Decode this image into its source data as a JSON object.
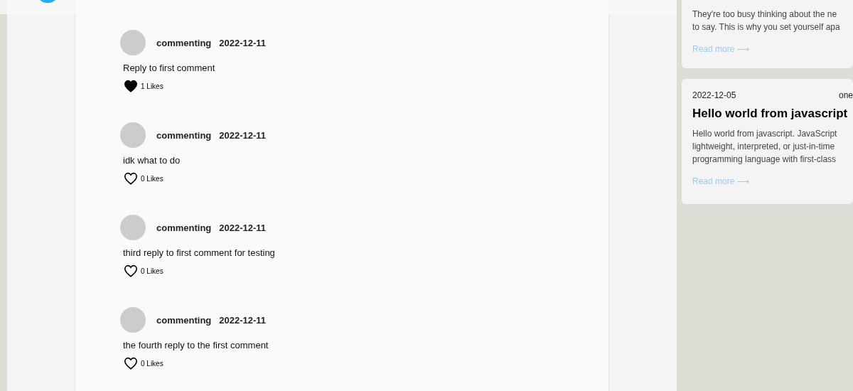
{
  "comments": [
    {
      "author": "commenting",
      "date": "2022-12-11",
      "text": "Reply to first comment",
      "liked": true,
      "likes": "1 Likes"
    },
    {
      "author": "commenting",
      "date": "2022-12-11",
      "text": "idk what to do",
      "liked": false,
      "likes": "0 Likes"
    },
    {
      "author": "commenting",
      "date": "2022-12-11",
      "text": "third reply to first comment for testing",
      "liked": false,
      "likes": "0 Likes"
    },
    {
      "author": "commenting",
      "date": "2022-12-11",
      "text": "the fourth reply to the first comment",
      "liked": false,
      "likes": "0 Likes"
    }
  ],
  "posts": [
    {
      "excerpt": [
        "They're too busy thinking about the ne",
        "to say. This is why you set yourself apa"
      ],
      "link": "Read more ⟶"
    },
    {
      "date": "2022-12-05",
      "meta": "one",
      "title": "Hello world from javascript",
      "excerpt": [
        "Hello world from javascript. JavaScript",
        "lightweight, interpreted, or just-in-time",
        "programming language with first-class"
      ],
      "link": "Read more ⟶"
    }
  ]
}
